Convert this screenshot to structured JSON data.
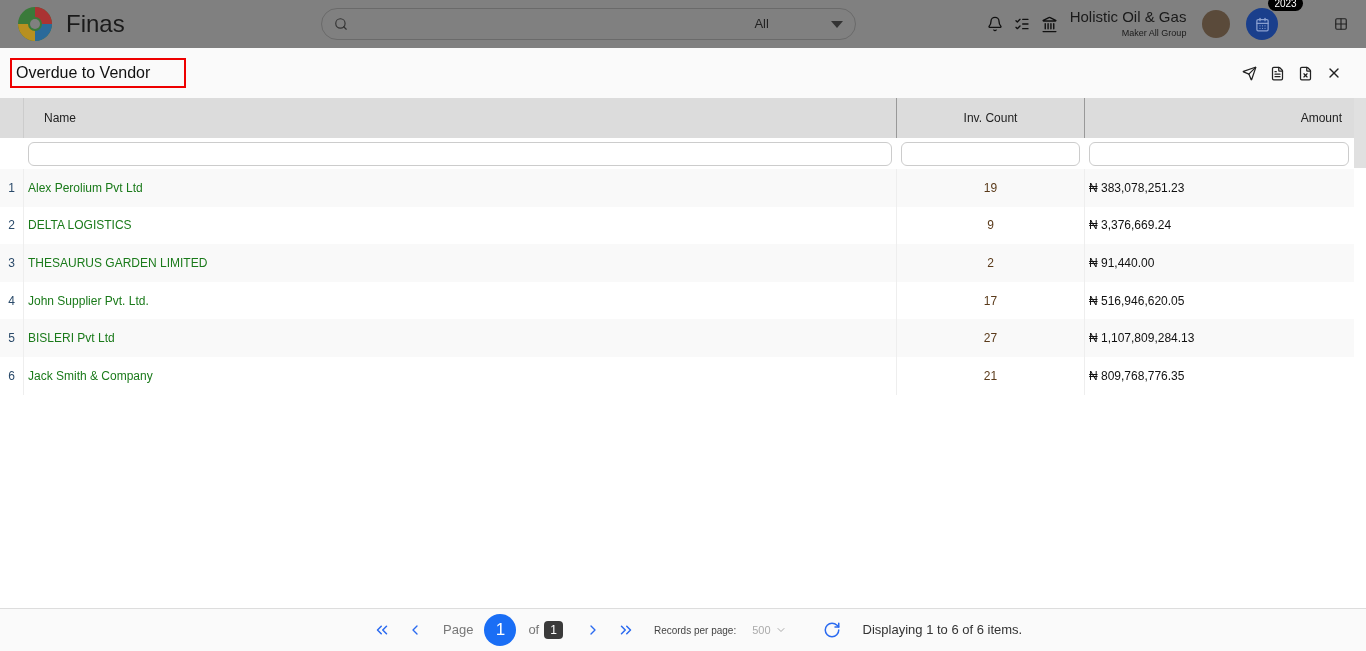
{
  "app": {
    "name": "Finas"
  },
  "search": {
    "filter": "All"
  },
  "company": {
    "name": "Holistic Oil & Gas",
    "group": "Maker All Group"
  },
  "year_badge": "2023",
  "report": {
    "title": "Overdue to Vendor"
  },
  "table": {
    "columns": [
      "Name",
      "Inv. Count",
      "Amount"
    ],
    "rows": [
      {
        "index": "1",
        "name": "Alex Perolium Pvt Ltd",
        "count": "19",
        "amount": "₦ 383,078,251.23"
      },
      {
        "index": "2",
        "name": "DELTA LOGISTICS",
        "count": "9",
        "amount": "₦ 3,376,669.24"
      },
      {
        "index": "3",
        "name": "THESAURUS GARDEN LIMITED",
        "count": "2",
        "amount": "₦ 91,440.00"
      },
      {
        "index": "4",
        "name": "John Supplier Pvt. Ltd.",
        "count": "17",
        "amount": "₦ 516,946,620.05"
      },
      {
        "index": "5",
        "name": "BISLERI Pvt Ltd",
        "count": "27",
        "amount": "₦ 1,107,809,284.13"
      },
      {
        "index": "6",
        "name": "Jack Smith & Company",
        "count": "21",
        "amount": "₦ 809,768,776.35"
      }
    ]
  },
  "pager": {
    "page_label": "Page",
    "page": "1",
    "of_label": "of",
    "total": "1",
    "records_label": "Records per page:",
    "records": "500",
    "summary": "Displaying 1 to 6 of 6 items."
  }
}
